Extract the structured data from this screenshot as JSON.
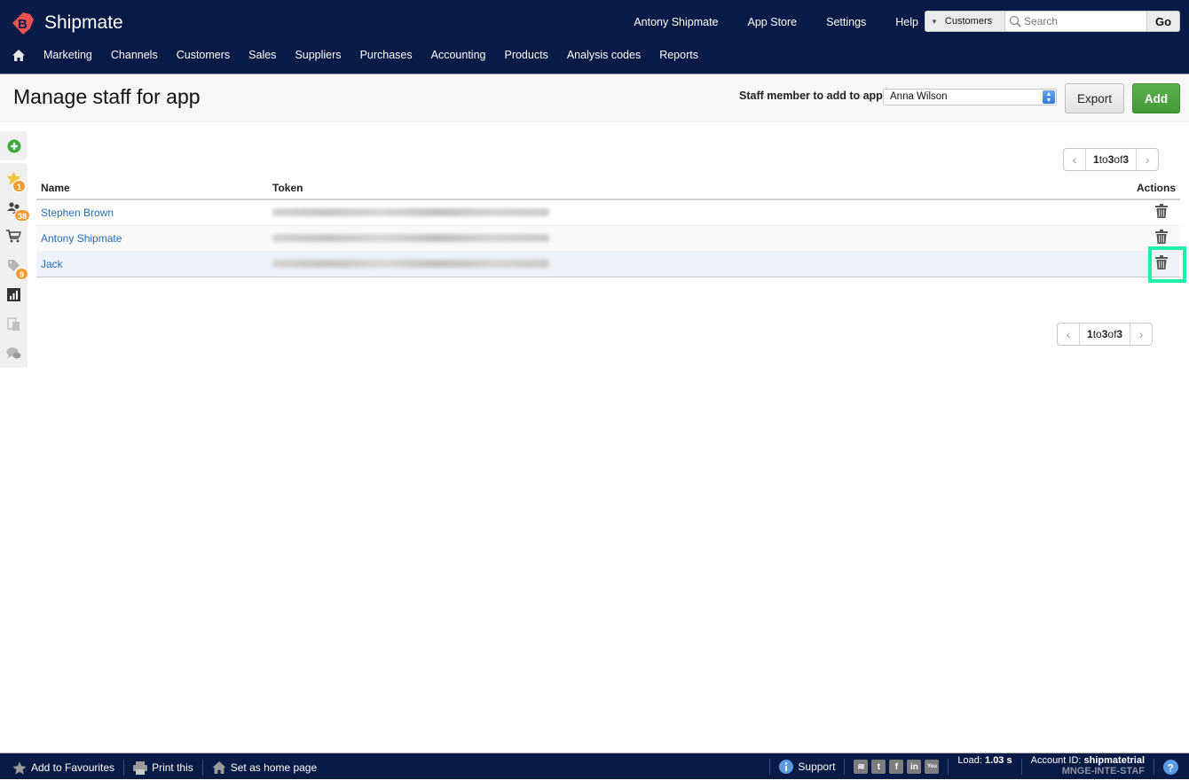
{
  "app": {
    "name": "Shipmate"
  },
  "topnav": {
    "links": [
      "Antony Shipmate",
      "App Store",
      "Settings",
      "Help"
    ],
    "search": {
      "scope": "Customers",
      "placeholder": "Search",
      "go_label": "Go"
    }
  },
  "mainnav": {
    "items": [
      "Marketing",
      "Channels",
      "Customers",
      "Sales",
      "Suppliers",
      "Purchases",
      "Accounting",
      "Products",
      "Analysis codes",
      "Reports"
    ]
  },
  "page": {
    "title": "Manage staff for app",
    "staff_label": "Staff member to add to app",
    "staff_selected": "Anna Wilson",
    "export_label": "Export",
    "add_label": "Add"
  },
  "sidebar": {
    "items": [
      {
        "icon": "add-icon",
        "badge": null
      },
      {
        "icon": "star-icon",
        "badge": null
      },
      {
        "icon": "users-icon",
        "badge": "1"
      },
      {
        "icon": "cart-icon",
        "badge": "38"
      },
      {
        "icon": "tag-icon",
        "badge": null
      },
      {
        "icon": "chart-icon",
        "badge": "9"
      },
      {
        "icon": "clipboard-icon",
        "badge": null
      },
      {
        "icon": "chat-icon",
        "badge": null
      }
    ]
  },
  "pager": {
    "from": "1",
    "to_word": "to",
    "to": "3",
    "of_word": "of",
    "total": "3"
  },
  "table": {
    "headers": {
      "name": "Name",
      "token": "Token",
      "actions": "Actions"
    },
    "rows": [
      {
        "name": "Stephen Brown",
        "token": "(blurred)"
      },
      {
        "name": "Antony Shipmate",
        "token": "(blurred)"
      },
      {
        "name": "Jack",
        "token": "(blurred)"
      }
    ]
  },
  "footer": {
    "add_favourites": "Add to Favourites",
    "print": "Print this",
    "home_page": "Set as home page",
    "support": "Support",
    "load_label": "Load:",
    "load_value": "1.03 s",
    "account_label": "Account ID:",
    "account_id": "shipmatetrial",
    "page_code": "MNGE-INTE-STAF"
  },
  "colors": {
    "nav_bg": "#0a1a47",
    "add_button": "#4fa643",
    "badge": "#f39c34",
    "link": "#1f6fb8",
    "highlight": "#1ef0a8"
  }
}
